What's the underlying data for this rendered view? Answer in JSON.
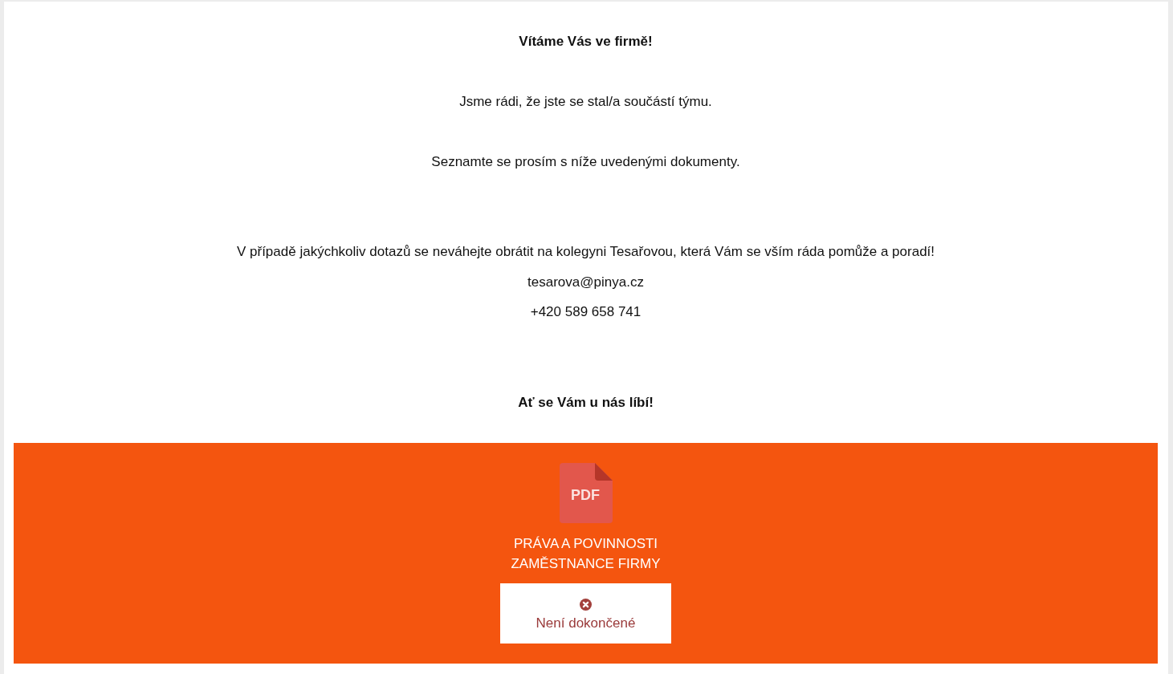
{
  "welcome": {
    "heading": "Vítáme Vás ve firmě!",
    "intro_paragraphs": [
      "Jsme rádi, že jste se stal/a součástí týmu.",
      "Seznamte se prosím s níže uvedenými dokumenty."
    ],
    "contact_note": "V případě jakýchkoliv dotazů se neváhejte obrátit na kolegyni Tesařovou, která Vám se vším ráda pomůže a poradí!",
    "contact_email": "tesarova@pinya.cz",
    "contact_phone": "+420 589 658 741",
    "closing": "Ať se Vám u nás líbí!"
  },
  "documents": [
    {
      "kind": "pdf",
      "file_label": "PDF",
      "title": "PRÁVA A POVINNOSTI ZAMĚSTNANCE FIRMY",
      "status": "Není dokončené",
      "completed": false
    }
  ]
}
